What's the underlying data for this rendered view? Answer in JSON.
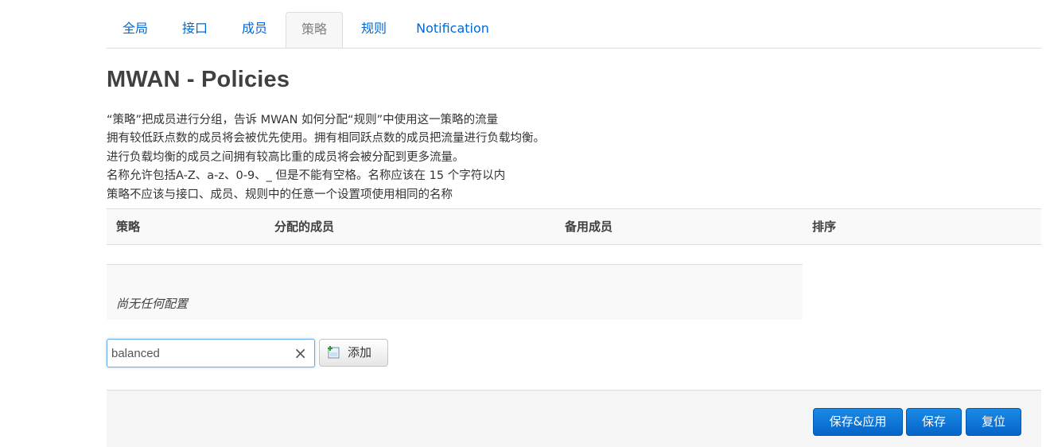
{
  "tabs": [
    {
      "label": "全局"
    },
    {
      "label": "接口"
    },
    {
      "label": "成员"
    },
    {
      "label": "策略",
      "active": true
    },
    {
      "label": "规则"
    },
    {
      "label": "Notification"
    }
  ],
  "page_title": "MWAN - Policies",
  "description": [
    "“策略”把成员进行分组，告诉 MWAN 如何分配“规则”中使用这一策略的流量",
    "拥有较低跃点数的成员将会被优先使用。拥有相同跃点数的成员把流量进行负载均衡。",
    "进行负载均衡的成员之间拥有较高比重的成员将会被分配到更多流量。",
    "名称允许包括A-Z、a-z、0-9、_ 但是不能有空格。名称应该在 15 个字符以内",
    "策略不应该与接口、成员、规则中的任意一个设置项使用相同的名称"
  ],
  "table": {
    "headers": [
      "策略",
      "分配的成员",
      "备用成员",
      "排序"
    ],
    "empty_text": "尚无任何配置"
  },
  "add_form": {
    "input_value": "balanced",
    "clear_icon": "×",
    "add_label": "添加",
    "add_icon": "add-icon"
  },
  "actions": {
    "save_apply": "保存&应用",
    "save": "保存",
    "reset": "复位"
  },
  "colors": {
    "link": "#0069d6",
    "primary_button": "#0a74d8",
    "header_bg": "#f9f9f9"
  }
}
